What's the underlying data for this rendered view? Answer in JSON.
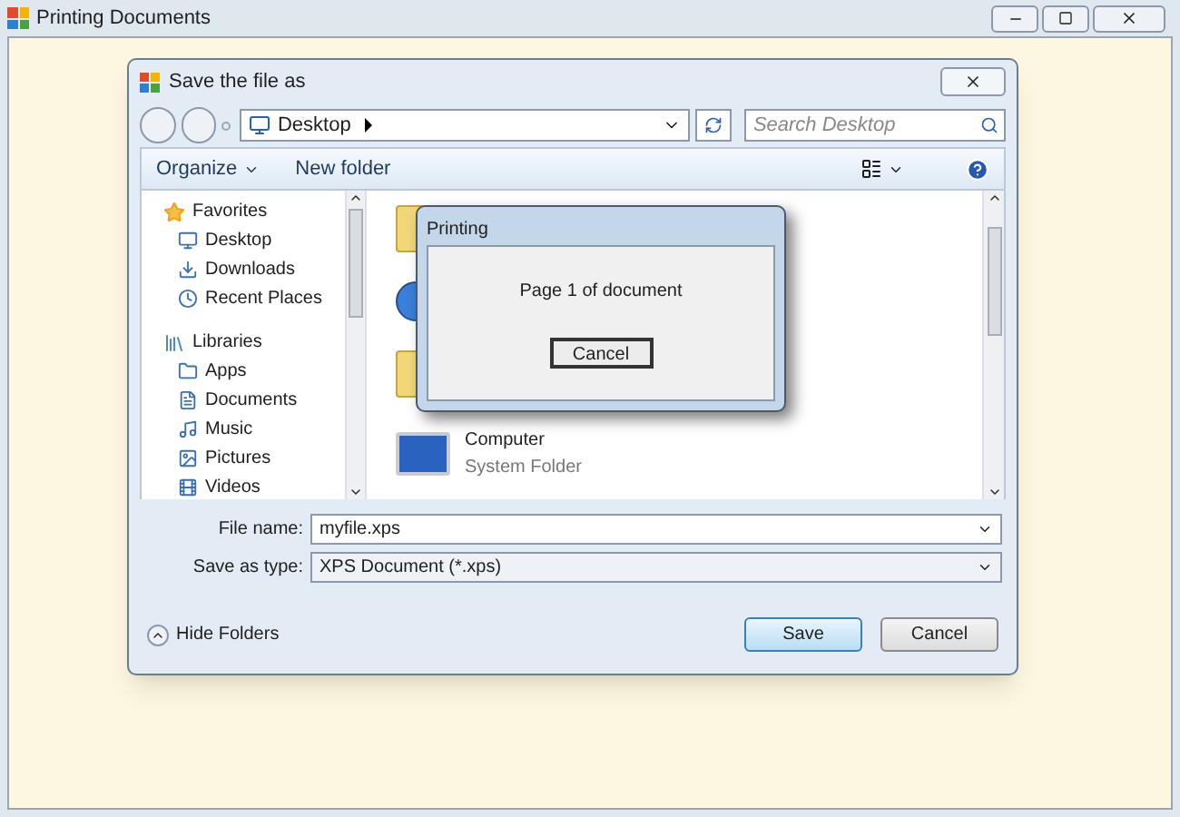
{
  "window": {
    "title": "Printing Documents"
  },
  "dialog": {
    "title": "Save the file as",
    "address": {
      "location": "Desktop"
    },
    "search": {
      "placeholder": "Search Desktop"
    },
    "toolbar": [
      "Organize",
      "New folder"
    ],
    "sidebar": [
      {
        "label": "Favorites",
        "children": [
          {
            "label": "Desktop"
          },
          {
            "label": "Downloads"
          },
          {
            "label": "Recent Places"
          }
        ]
      },
      {
        "label": "Libraries",
        "children": [
          {
            "label": "Apps"
          },
          {
            "label": "Documents"
          },
          {
            "label": "Music"
          },
          {
            "label": "Pictures"
          },
          {
            "label": "Videos"
          }
        ]
      }
    ],
    "files": [
      {
        "kind": "folder"
      },
      {
        "kind": "network"
      },
      {
        "kind": "folder"
      },
      {
        "kind": "computer",
        "name": "Computer",
        "type": "System Folder"
      }
    ],
    "file_name": {
      "label": "File name:",
      "value": "myfile.xps"
    },
    "save_type": {
      "label": "Save as type:",
      "value": "XPS Document (*.xps)"
    },
    "hide_folders": "Hide Folders",
    "buttons": [
      {
        "label": "Save",
        "highlighted": true
      },
      {
        "label": "Cancel",
        "highlighted": false
      }
    ]
  },
  "printing": {
    "title": "Printing",
    "message": "Page 1 of document",
    "button": "Cancel"
  }
}
